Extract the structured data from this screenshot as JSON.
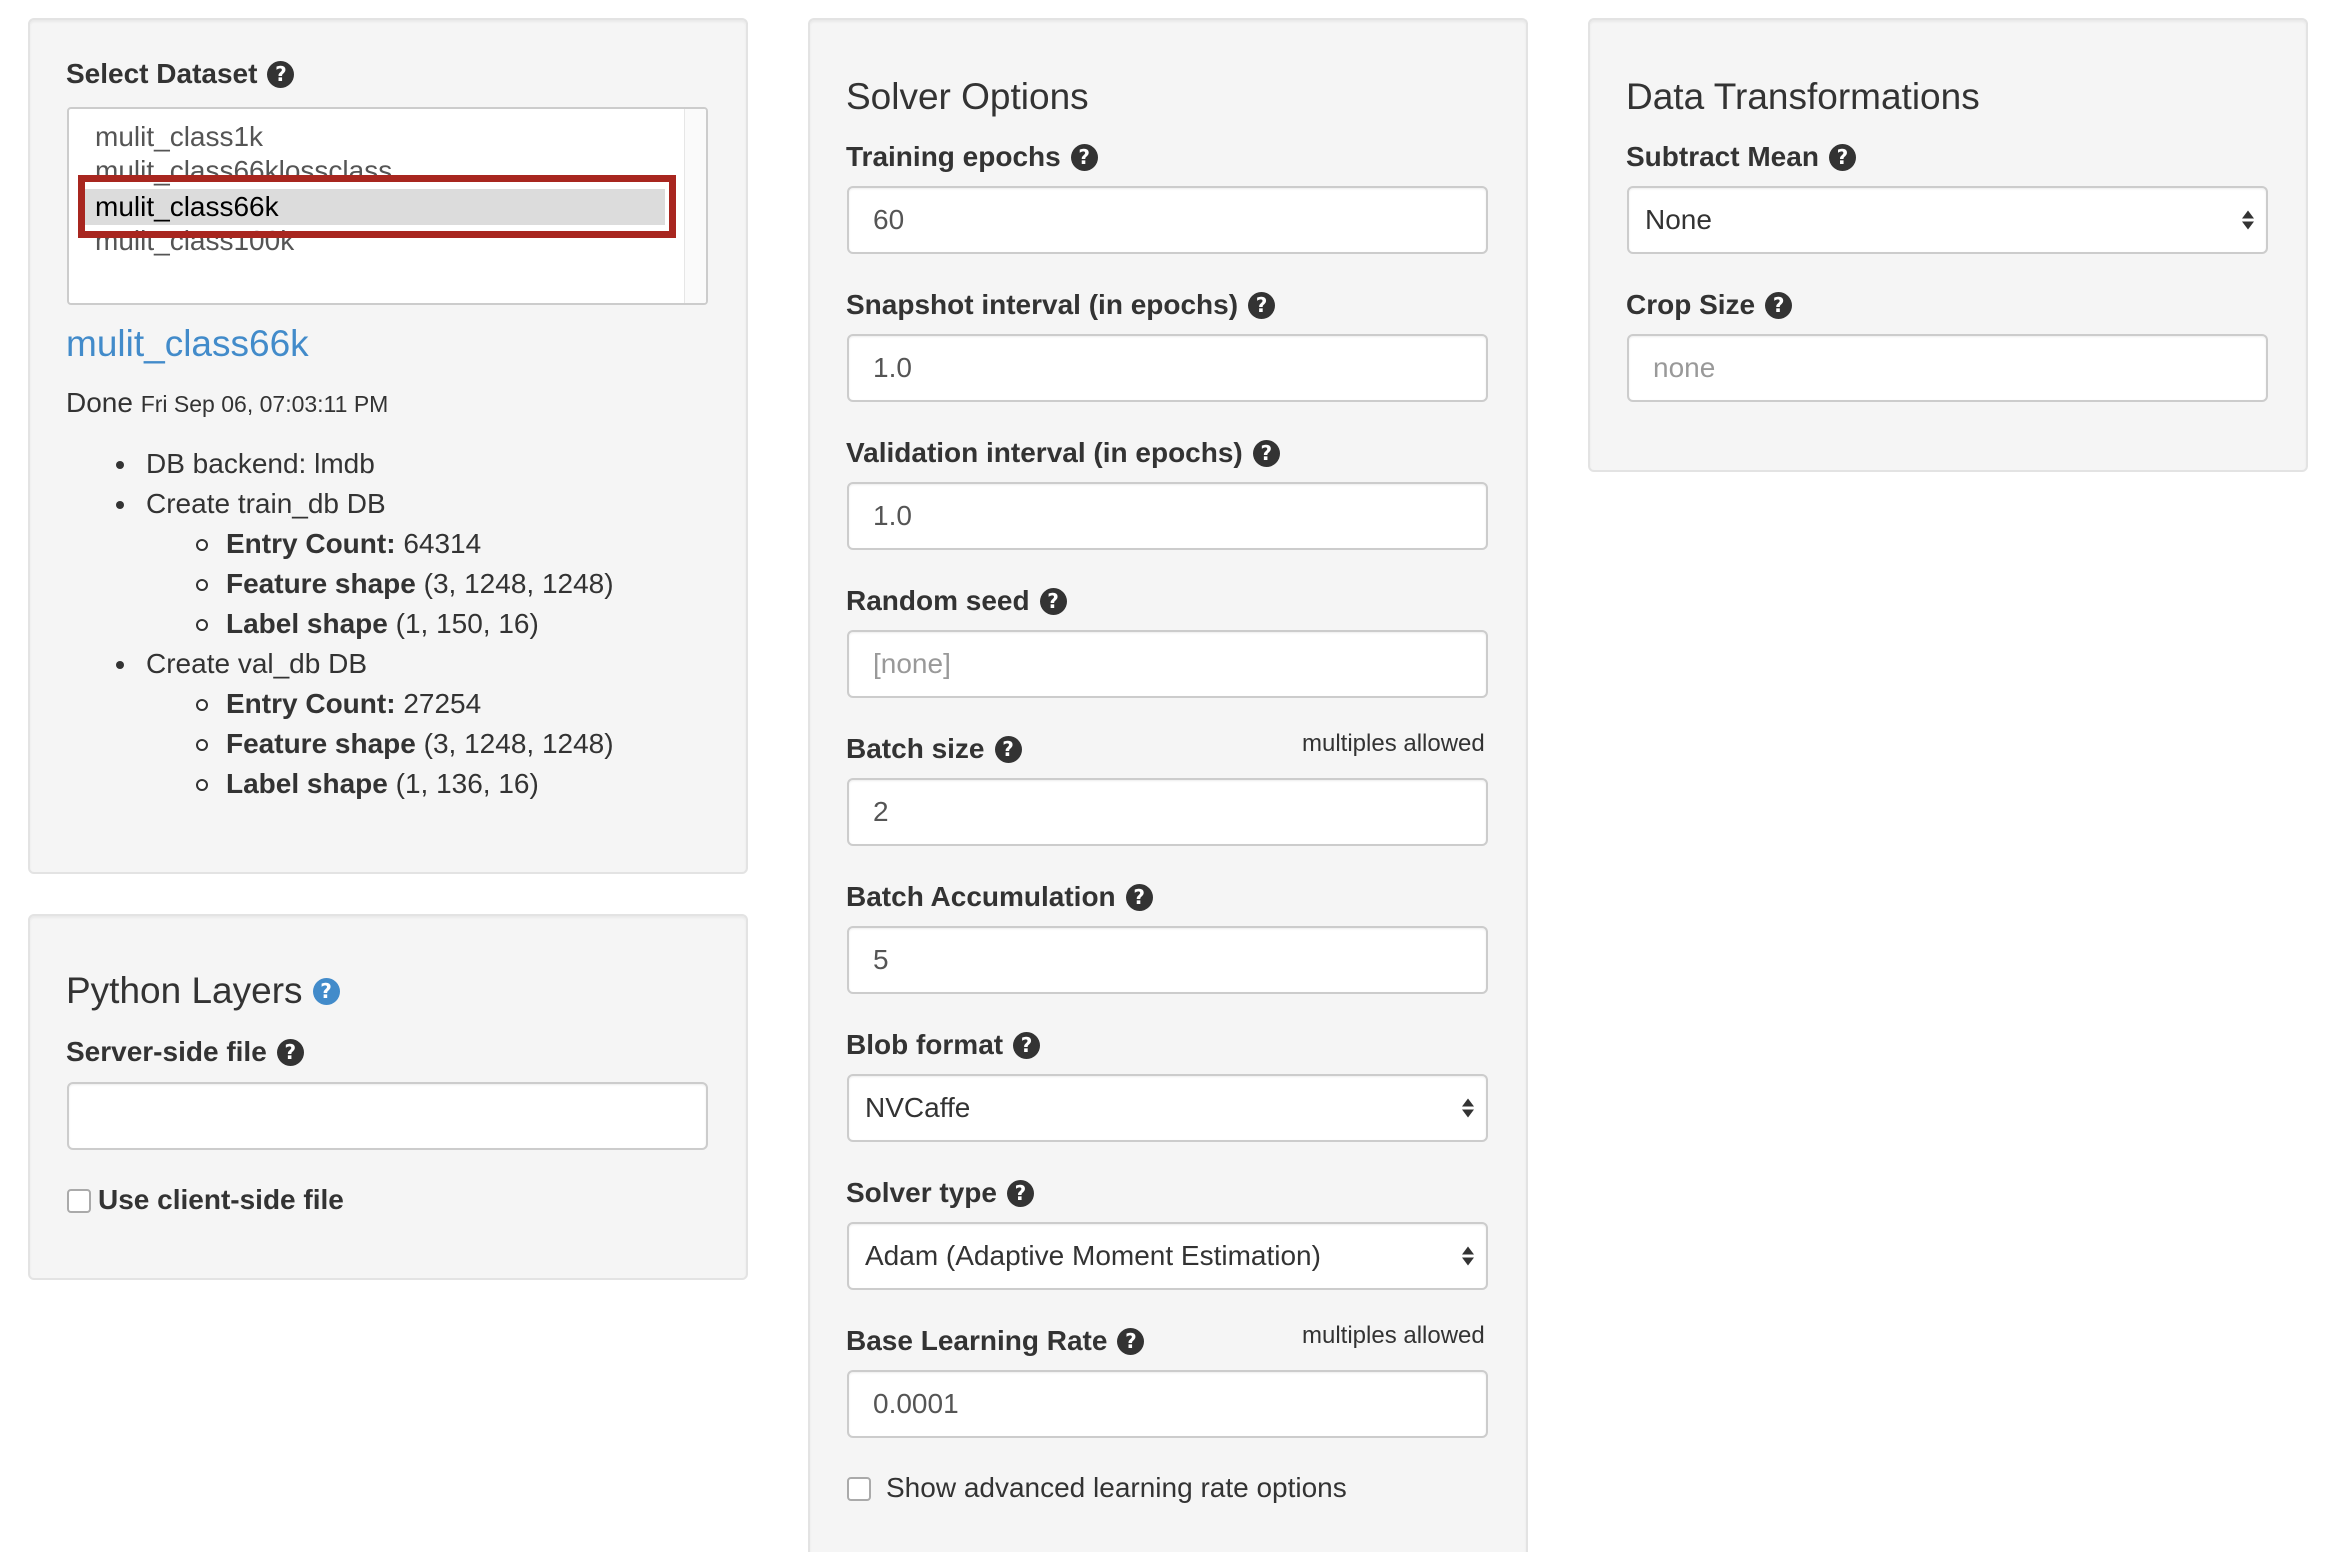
{
  "dataset": {
    "label": "Select Dataset",
    "options": [
      "mulit_class1k",
      "mulit_class66klossclass",
      "mulit_class66k",
      "mulit_class100k"
    ],
    "selected": "mulit_class66k",
    "selected_name": "mulit_class66k",
    "status": "Done",
    "timestamp": "Fri Sep 06, 07:03:11 PM",
    "backend": "DB backend: lmdb",
    "train_db": {
      "title": "Create train_db DB",
      "entry_count_label": "Entry Count:",
      "entry_count": "64314",
      "feature_shape_label": "Feature shape",
      "feature_shape": "(3, 1248, 1248)",
      "label_shape_label": "Label shape",
      "label_shape": "(1, 150, 16)"
    },
    "val_db": {
      "title": "Create val_db DB",
      "entry_count_label": "Entry Count:",
      "entry_count": "27254",
      "feature_shape_label": "Feature shape",
      "feature_shape": "(3, 1248, 1248)",
      "label_shape_label": "Label shape",
      "label_shape": "(1, 136, 16)"
    }
  },
  "python_layers": {
    "title": "Python Layers",
    "server_file_label": "Server-side file",
    "server_file_value": "",
    "client_file_label": "Use client-side file"
  },
  "solver": {
    "title": "Solver Options",
    "training_epochs_label": "Training epochs",
    "training_epochs": "60",
    "snapshot_label": "Snapshot interval (in epochs)",
    "snapshot": "1.0",
    "validation_label": "Validation interval (in epochs)",
    "validation": "1.0",
    "seed_label": "Random seed",
    "seed_placeholder": "[none]",
    "batch_size_label": "Batch size",
    "batch_size_hint": "multiples allowed",
    "batch_size": "2",
    "batch_accum_label": "Batch Accumulation",
    "batch_accum": "5",
    "blob_format_label": "Blob format",
    "blob_format": "NVCaffe",
    "solver_type_label": "Solver type",
    "solver_type": "Adam (Adaptive Moment Estimation)",
    "base_lr_label": "Base Learning Rate",
    "base_lr_hint": "multiples allowed",
    "base_lr": "0.0001",
    "advanced_lr_label": "Show advanced learning rate options"
  },
  "transforms": {
    "title": "Data Transformations",
    "subtract_mean_label": "Subtract Mean",
    "subtract_mean": "None",
    "crop_size_label": "Crop Size",
    "crop_size_placeholder": "none"
  },
  "icons": {
    "help": "question-circle-icon",
    "help_blue_color": "#428bca",
    "link_color": "#428bca",
    "highlight_color": "#a8261f"
  }
}
